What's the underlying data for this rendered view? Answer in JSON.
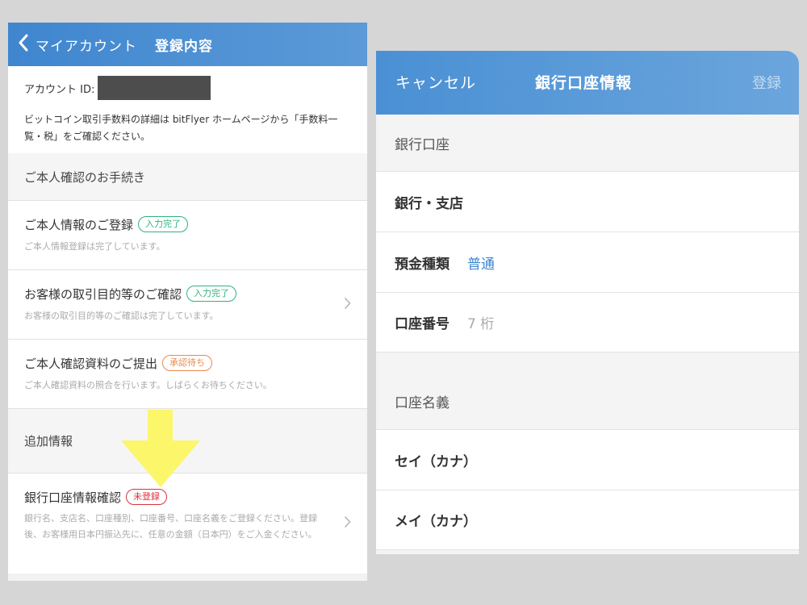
{
  "left": {
    "nav": {
      "back_label": "マイアカウント",
      "title": "登録内容"
    },
    "account_id_label": "アカウント ID:",
    "fee_note": "ビットコイン取引手数料の詳細は bitFlyer ホームページから「手数料一覧・税」をご確認ください。",
    "identity_section": "ご本人確認のお手続き",
    "items": [
      {
        "title": "ご本人情報のご登録",
        "badge": "入力完了",
        "sub": "ご本人情報登録は完了しています。"
      },
      {
        "title": "お客様の取引目的等のご確認",
        "badge": "入力完了",
        "sub": "お客様の取引目的等のご確認は完了しています。"
      },
      {
        "title": "ご本人確認資料のご提出",
        "badge": "承認待ち",
        "sub": "ご本人確認資料の照合を行います。しばらくお待ちください。"
      }
    ],
    "additional_section": "追加情報",
    "bank": {
      "title": "銀行口座情報確認",
      "badge": "未登録",
      "sub": "銀行名、支店名、口座種別、口座番号、口座名義をご登録ください。登録後、お客様用日本円振込先に、任意の金額（日本円）をご入金ください。"
    }
  },
  "right": {
    "nav": {
      "cancel": "キャンセル",
      "title": "銀行口座情報",
      "register": "登録"
    },
    "section_bank": "銀行口座",
    "bank_branch_label": "銀行・支店",
    "deposit_type_label": "預金種類",
    "deposit_type_value": "普通",
    "account_number_label": "口座番号",
    "account_number_placeholder": "7 桁",
    "section_holder": "口座名義",
    "sei_label": "セイ（カナ）",
    "mei_label": "メイ（カナ）"
  },
  "colors": {
    "nav_blue": "#4a90d4",
    "badge_green": "#2fb37f",
    "badge_orange": "#e98a4b",
    "badge_red": "#d8323f",
    "arrow_yellow": "#fcf66a"
  },
  "icons": [
    "chevron-left-icon",
    "chevron-right-icon",
    "down-arrow-icon"
  ]
}
